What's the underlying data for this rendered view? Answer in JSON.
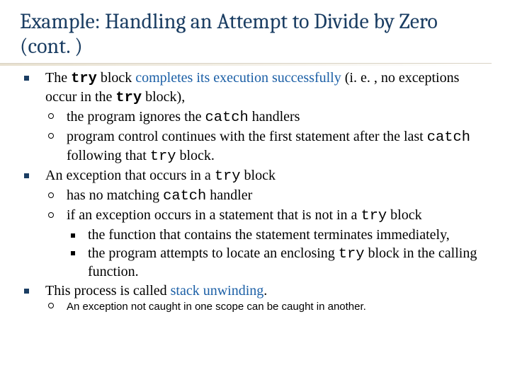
{
  "title": "Example: Handling an Attempt to Divide by Zero (cont. )",
  "b1_pre": "The ",
  "b1_try": "try",
  "b1_mid1": " block ",
  "b1_hl": "completes its execution successfully",
  "b1_mid2": " (i. e. , no exceptions occur in the ",
  "b1_post": " block),",
  "b1s1_pre": "the program ignores the ",
  "b1s1_catch": "catch",
  "b1s1_post": " handlers",
  "b1s2_pre": "program control continues with the first statement after the last ",
  "b1s2_catch": "catch",
  "b1s2_mid": " following that ",
  "b1s2_try": "try",
  "b1s2_post": " block.",
  "b2_pre": "An exception that occurs in a ",
  "b2_try": "try",
  "b2_post": " block",
  "b2s1_pre": "has no matching ",
  "b2s1_catch": "catch",
  "b2s1_post": " handler",
  "b2s2_pre": "if an exception occurs in a statement that is not in a ",
  "b2s2_try": "try",
  "b2s2_post": " block",
  "b2s2a": "the function that contains the statement terminates immediately,",
  "b2s2b_pre": "the program attempts to locate an enclosing ",
  "b2s2b_try": "try",
  "b2s2b_post": " block in the calling function.",
  "b3_pre": "This process is called ",
  "b3_hl": "stack unwinding",
  "b3_post": ".",
  "note": "An exception not caught in one scope can be caught in another."
}
